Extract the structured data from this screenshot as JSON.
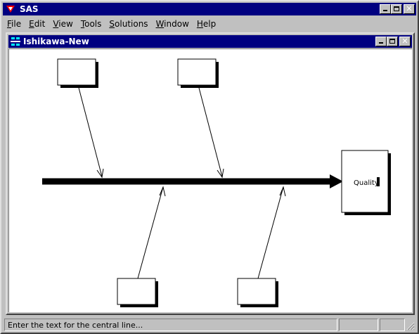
{
  "app": {
    "title": "SAS",
    "menu": [
      {
        "pre": "",
        "u": "F",
        "post": "ile"
      },
      {
        "pre": "",
        "u": "E",
        "post": "dit"
      },
      {
        "pre": "",
        "u": "V",
        "post": "iew"
      },
      {
        "pre": "",
        "u": "T",
        "post": "ools"
      },
      {
        "pre": "",
        "u": "S",
        "post": "olutions"
      },
      {
        "pre": "",
        "u": "W",
        "post": "indow"
      },
      {
        "pre": "",
        "u": "H",
        "post": "elp"
      }
    ]
  },
  "child_window": {
    "title": "Ishikawa-New"
  },
  "diagram": {
    "effect_text": "Quality",
    "cause_boxes": [
      {
        "id": "top-left",
        "text": ""
      },
      {
        "id": "top-right",
        "text": ""
      },
      {
        "id": "bottom-left",
        "text": ""
      },
      {
        "id": "bottom-right",
        "text": ""
      }
    ]
  },
  "status": {
    "message": "Enter the text for the central line..."
  },
  "colors": {
    "titlebar": "#000080",
    "face": "#c0c0c0",
    "canvas": "#ffffff",
    "ink": "#000000"
  },
  "icons": [
    "sas-logo-icon",
    "minimize-icon",
    "maximize-icon",
    "close-icon",
    "diagram-window-icon",
    "size-grip-icon"
  ]
}
